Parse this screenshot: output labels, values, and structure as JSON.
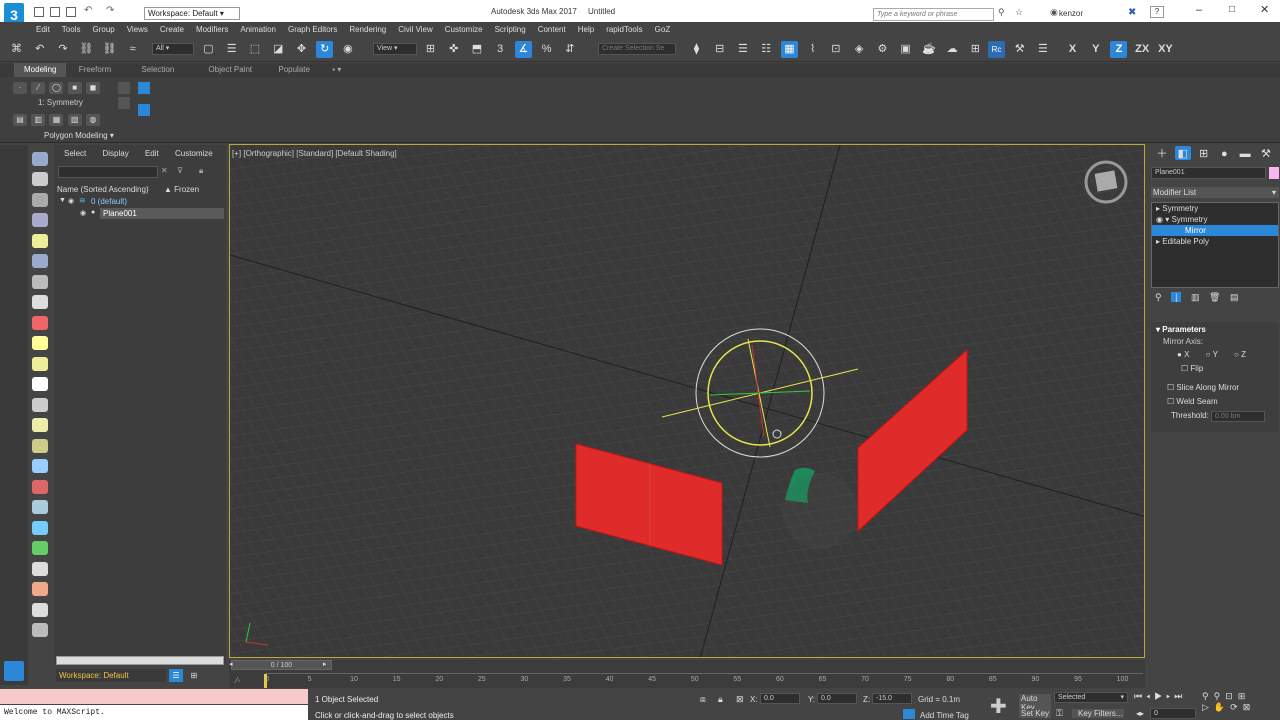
{
  "titlebar": {
    "workspace": "Workspace: Default",
    "app_title": "Autodesk 3ds Max 2017",
    "doc_title": "Untitled",
    "search_placeholder": "Type a keyword or phrase",
    "user": "kenzor"
  },
  "menu": [
    "Edit",
    "Tools",
    "Group",
    "Views",
    "Create",
    "Modifiers",
    "Animation",
    "Graph Editors",
    "Rendering",
    "Civil View",
    "Customize",
    "Scripting",
    "Content",
    "Help",
    "rapidTools",
    "GoZ"
  ],
  "toolbar": {
    "filter_value": "All",
    "view_value": "View",
    "selection_set_placeholder": "Create Selection Se",
    "axis_labels": [
      "X",
      "Y",
      "Z",
      "ZX",
      "XY"
    ]
  },
  "ribbon": {
    "tabs": [
      "Modeling",
      "Freeform",
      "Selection",
      "Object Paint",
      "Populate"
    ],
    "modifier_label": "1: Symmetry",
    "panel_label": "Polygon Modeling ▾"
  },
  "scene_explorer": {
    "menu": [
      "Select",
      "Display",
      "Edit",
      "Customize"
    ],
    "col_name": "Name (Sorted Ascending)",
    "col_frozen": "▲ Frozen",
    "layer": "0 (default)",
    "object": "Plane001",
    "workspace": "Workspace: Default"
  },
  "viewport": {
    "label": "[+] [Orthographic] [Standard] [Default Shading]"
  },
  "right_panel": {
    "object_name": "Plane001",
    "modifier_list": "Modifier List",
    "stack": [
      "Symmetry",
      "Symmetry",
      "Mirror",
      "Editable Poly"
    ],
    "rollout_title": "Parameters",
    "mirror_axis_label": "Mirror Axis:",
    "axes": [
      "X",
      "Y",
      "Z"
    ],
    "flip": "Flip",
    "slice": "Slice Along Mirror",
    "weld": "Weld Seam",
    "threshold_label": "Threshold:",
    "threshold_value": "0.00 bm"
  },
  "timeline": {
    "frame_label": "0 / 100",
    "ticks": [
      "0",
      "5",
      "10",
      "15",
      "20",
      "25",
      "30",
      "35",
      "40",
      "45",
      "50",
      "55",
      "60",
      "65",
      "70",
      "75",
      "80",
      "85",
      "90",
      "95",
      "100"
    ]
  },
  "status": {
    "maxscript": "Welcome to MAXScript.",
    "selected": "1 Object Selected",
    "prompt": "Click or click-and-drag to select objects",
    "x_label": "X:",
    "x_value": "0.0",
    "y_label": "Y:",
    "y_value": "0.0",
    "z_label": "Z:",
    "z_value": "-15.0",
    "grid": "Grid = 0.1m",
    "add_time_tag": "Add Time Tag",
    "auto_key": "Auto Key",
    "set_key": "Set Key",
    "key_filters": "Key Filters...",
    "selected_dd": "Selected",
    "frame_value": "0"
  },
  "colors": {
    "accent": "#2c87d8",
    "plane_red": "#e02b2b",
    "gizmo_yellow": "#e8e84a",
    "viewport_border": "#b7a93a"
  }
}
